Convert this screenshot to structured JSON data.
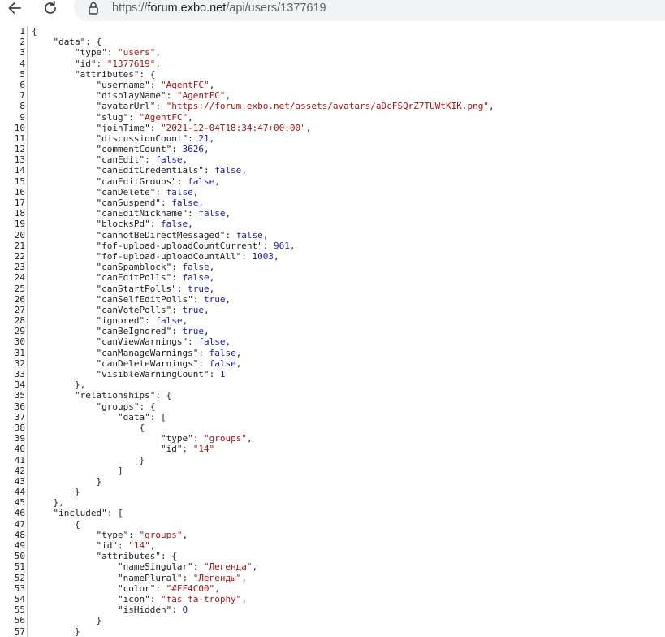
{
  "browser": {
    "url": "https://forum.exbo.net/api/users/1377619",
    "url_scheme": "https://",
    "url_host": "forum.exbo.net",
    "url_path": "/api/users/1377619"
  },
  "lines": [
    {
      "n": "1",
      "indent": "",
      "tokens": [
        [
          "p",
          "{"
        ]
      ]
    },
    {
      "n": "2",
      "indent": "    ",
      "tokens": [
        [
          "k",
          "\"data\""
        ],
        [
          "p",
          ": {"
        ]
      ]
    },
    {
      "n": "3",
      "indent": "        ",
      "tokens": [
        [
          "k",
          "\"type\""
        ],
        [
          "p",
          ": "
        ],
        [
          "s",
          "\"users\""
        ],
        [
          "p",
          ","
        ]
      ]
    },
    {
      "n": "4",
      "indent": "        ",
      "tokens": [
        [
          "k",
          "\"id\""
        ],
        [
          "p",
          ": "
        ],
        [
          "s",
          "\"1377619\""
        ],
        [
          "p",
          ","
        ]
      ]
    },
    {
      "n": "5",
      "indent": "        ",
      "tokens": [
        [
          "k",
          "\"attributes\""
        ],
        [
          "p",
          ": {"
        ]
      ]
    },
    {
      "n": "6",
      "indent": "            ",
      "tokens": [
        [
          "k",
          "\"username\""
        ],
        [
          "p",
          ": "
        ],
        [
          "s",
          "\"AgentFC\""
        ],
        [
          "p",
          ","
        ]
      ]
    },
    {
      "n": "7",
      "indent": "            ",
      "tokens": [
        [
          "k",
          "\"displayName\""
        ],
        [
          "p",
          ": "
        ],
        [
          "s",
          "\"AgentFC\""
        ],
        [
          "p",
          ","
        ]
      ]
    },
    {
      "n": "8",
      "indent": "            ",
      "tokens": [
        [
          "k",
          "\"avatarUrl\""
        ],
        [
          "p",
          ": "
        ],
        [
          "s",
          "\"https://forum.exbo.net/assets/avatars/aDcFSQrZ7TUWtKIK.png\""
        ],
        [
          "p",
          ","
        ]
      ]
    },
    {
      "n": "9",
      "indent": "            ",
      "tokens": [
        [
          "k",
          "\"slug\""
        ],
        [
          "p",
          ": "
        ],
        [
          "s",
          "\"AgentFC\""
        ],
        [
          "p",
          ","
        ]
      ]
    },
    {
      "n": "10",
      "indent": "            ",
      "tokens": [
        [
          "k",
          "\"joinTime\""
        ],
        [
          "p",
          ": "
        ],
        [
          "s",
          "\"2021-12-04T18:34:47+00:00\""
        ],
        [
          "p",
          ","
        ]
      ]
    },
    {
      "n": "11",
      "indent": "            ",
      "tokens": [
        [
          "k",
          "\"discussionCount\""
        ],
        [
          "p",
          ": "
        ],
        [
          "n",
          "21"
        ],
        [
          "p",
          ","
        ]
      ]
    },
    {
      "n": "12",
      "indent": "            ",
      "tokens": [
        [
          "k",
          "\"commentCount\""
        ],
        [
          "p",
          ": "
        ],
        [
          "n",
          "3626"
        ],
        [
          "p",
          ","
        ]
      ]
    },
    {
      "n": "13",
      "indent": "            ",
      "tokens": [
        [
          "k",
          "\"canEdit\""
        ],
        [
          "p",
          ": "
        ],
        [
          "b",
          "false"
        ],
        [
          "p",
          ","
        ]
      ]
    },
    {
      "n": "14",
      "indent": "            ",
      "tokens": [
        [
          "k",
          "\"canEditCredentials\""
        ],
        [
          "p",
          ": "
        ],
        [
          "b",
          "false"
        ],
        [
          "p",
          ","
        ]
      ]
    },
    {
      "n": "15",
      "indent": "            ",
      "tokens": [
        [
          "k",
          "\"canEditGroups\""
        ],
        [
          "p",
          ": "
        ],
        [
          "b",
          "false"
        ],
        [
          "p",
          ","
        ]
      ]
    },
    {
      "n": "16",
      "indent": "            ",
      "tokens": [
        [
          "k",
          "\"canDelete\""
        ],
        [
          "p",
          ": "
        ],
        [
          "b",
          "false"
        ],
        [
          "p",
          ","
        ]
      ]
    },
    {
      "n": "17",
      "indent": "            ",
      "tokens": [
        [
          "k",
          "\"canSuspend\""
        ],
        [
          "p",
          ": "
        ],
        [
          "b",
          "false"
        ],
        [
          "p",
          ","
        ]
      ]
    },
    {
      "n": "18",
      "indent": "            ",
      "tokens": [
        [
          "k",
          "\"canEditNickname\""
        ],
        [
          "p",
          ": "
        ],
        [
          "b",
          "false"
        ],
        [
          "p",
          ","
        ]
      ]
    },
    {
      "n": "19",
      "indent": "            ",
      "tokens": [
        [
          "k",
          "\"blocksPd\""
        ],
        [
          "p",
          ": "
        ],
        [
          "b",
          "false"
        ],
        [
          "p",
          ","
        ]
      ]
    },
    {
      "n": "20",
      "indent": "            ",
      "tokens": [
        [
          "k",
          "\"cannotBeDirectMessaged\""
        ],
        [
          "p",
          ": "
        ],
        [
          "b",
          "false"
        ],
        [
          "p",
          ","
        ]
      ]
    },
    {
      "n": "21",
      "indent": "            ",
      "tokens": [
        [
          "k",
          "\"fof-upload-uploadCountCurrent\""
        ],
        [
          "p",
          ": "
        ],
        [
          "n",
          "961"
        ],
        [
          "p",
          ","
        ]
      ]
    },
    {
      "n": "22",
      "indent": "            ",
      "tokens": [
        [
          "k",
          "\"fof-upload-uploadCountAll\""
        ],
        [
          "p",
          ": "
        ],
        [
          "n",
          "1003"
        ],
        [
          "p",
          ","
        ]
      ]
    },
    {
      "n": "23",
      "indent": "            ",
      "tokens": [
        [
          "k",
          "\"canSpamblock\""
        ],
        [
          "p",
          ": "
        ],
        [
          "b",
          "false"
        ],
        [
          "p",
          ","
        ]
      ]
    },
    {
      "n": "24",
      "indent": "            ",
      "tokens": [
        [
          "k",
          "\"canEditPolls\""
        ],
        [
          "p",
          ": "
        ],
        [
          "b",
          "false"
        ],
        [
          "p",
          ","
        ]
      ]
    },
    {
      "n": "25",
      "indent": "            ",
      "tokens": [
        [
          "k",
          "\"canStartPolls\""
        ],
        [
          "p",
          ": "
        ],
        [
          "b",
          "true"
        ],
        [
          "p",
          ","
        ]
      ]
    },
    {
      "n": "26",
      "indent": "            ",
      "tokens": [
        [
          "k",
          "\"canSelfEditPolls\""
        ],
        [
          "p",
          ": "
        ],
        [
          "b",
          "true"
        ],
        [
          "p",
          ","
        ]
      ]
    },
    {
      "n": "27",
      "indent": "            ",
      "tokens": [
        [
          "k",
          "\"canVotePolls\""
        ],
        [
          "p",
          ": "
        ],
        [
          "b",
          "true"
        ],
        [
          "p",
          ","
        ]
      ]
    },
    {
      "n": "28",
      "indent": "            ",
      "tokens": [
        [
          "k",
          "\"ignored\""
        ],
        [
          "p",
          ": "
        ],
        [
          "b",
          "false"
        ],
        [
          "p",
          ","
        ]
      ]
    },
    {
      "n": "29",
      "indent": "            ",
      "tokens": [
        [
          "k",
          "\"canBeIgnored\""
        ],
        [
          "p",
          ": "
        ],
        [
          "b",
          "true"
        ],
        [
          "p",
          ","
        ]
      ]
    },
    {
      "n": "30",
      "indent": "            ",
      "tokens": [
        [
          "k",
          "\"canViewWarnings\""
        ],
        [
          "p",
          ": "
        ],
        [
          "b",
          "false"
        ],
        [
          "p",
          ","
        ]
      ]
    },
    {
      "n": "31",
      "indent": "            ",
      "tokens": [
        [
          "k",
          "\"canManageWarnings\""
        ],
        [
          "p",
          ": "
        ],
        [
          "b",
          "false"
        ],
        [
          "p",
          ","
        ]
      ]
    },
    {
      "n": "32",
      "indent": "            ",
      "tokens": [
        [
          "k",
          "\"canDeleteWarnings\""
        ],
        [
          "p",
          ": "
        ],
        [
          "b",
          "false"
        ],
        [
          "p",
          ","
        ]
      ]
    },
    {
      "n": "33",
      "indent": "            ",
      "tokens": [
        [
          "k",
          "\"visibleWarningCount\""
        ],
        [
          "p",
          ": "
        ],
        [
          "n",
          "1"
        ]
      ]
    },
    {
      "n": "34",
      "indent": "        ",
      "tokens": [
        [
          "p",
          "},"
        ]
      ]
    },
    {
      "n": "35",
      "indent": "        ",
      "tokens": [
        [
          "k",
          "\"relationships\""
        ],
        [
          "p",
          ": {"
        ]
      ]
    },
    {
      "n": "36",
      "indent": "            ",
      "tokens": [
        [
          "k",
          "\"groups\""
        ],
        [
          "p",
          ": {"
        ]
      ]
    },
    {
      "n": "37",
      "indent": "                ",
      "tokens": [
        [
          "k",
          "\"data\""
        ],
        [
          "p",
          ": ["
        ]
      ]
    },
    {
      "n": "38",
      "indent": "                    ",
      "tokens": [
        [
          "p",
          "{"
        ]
      ]
    },
    {
      "n": "39",
      "indent": "                        ",
      "tokens": [
        [
          "k",
          "\"type\""
        ],
        [
          "p",
          ": "
        ],
        [
          "s",
          "\"groups\""
        ],
        [
          "p",
          ","
        ]
      ]
    },
    {
      "n": "40",
      "indent": "                        ",
      "tokens": [
        [
          "k",
          "\"id\""
        ],
        [
          "p",
          ": "
        ],
        [
          "s",
          "\"14\""
        ]
      ]
    },
    {
      "n": "41",
      "indent": "                    ",
      "tokens": [
        [
          "p",
          "}"
        ]
      ]
    },
    {
      "n": "42",
      "indent": "                ",
      "tokens": [
        [
          "p",
          "]"
        ]
      ]
    },
    {
      "n": "43",
      "indent": "            ",
      "tokens": [
        [
          "p",
          "}"
        ]
      ]
    },
    {
      "n": "44",
      "indent": "        ",
      "tokens": [
        [
          "p",
          "}"
        ]
      ]
    },
    {
      "n": "45",
      "indent": "    ",
      "tokens": [
        [
          "p",
          "},"
        ]
      ]
    },
    {
      "n": "46",
      "indent": "    ",
      "tokens": [
        [
          "k",
          "\"included\""
        ],
        [
          "p",
          ": ["
        ]
      ]
    },
    {
      "n": "47",
      "indent": "        ",
      "tokens": [
        [
          "p",
          "{"
        ]
      ]
    },
    {
      "n": "48",
      "indent": "            ",
      "tokens": [
        [
          "k",
          "\"type\""
        ],
        [
          "p",
          ": "
        ],
        [
          "s",
          "\"groups\""
        ],
        [
          "p",
          ","
        ]
      ]
    },
    {
      "n": "49",
      "indent": "            ",
      "tokens": [
        [
          "k",
          "\"id\""
        ],
        [
          "p",
          ": "
        ],
        [
          "s",
          "\"14\""
        ],
        [
          "p",
          ","
        ]
      ]
    },
    {
      "n": "50",
      "indent": "            ",
      "tokens": [
        [
          "k",
          "\"attributes\""
        ],
        [
          "p",
          ": {"
        ]
      ]
    },
    {
      "n": "51",
      "indent": "                ",
      "tokens": [
        [
          "k",
          "\"nameSingular\""
        ],
        [
          "p",
          ": "
        ],
        [
          "s",
          "\"Легенда\""
        ],
        [
          "p",
          ","
        ]
      ]
    },
    {
      "n": "52",
      "indent": "                ",
      "tokens": [
        [
          "k",
          "\"namePlural\""
        ],
        [
          "p",
          ": "
        ],
        [
          "s",
          "\"Легенды\""
        ],
        [
          "p",
          ","
        ]
      ]
    },
    {
      "n": "53",
      "indent": "                ",
      "tokens": [
        [
          "k",
          "\"color\""
        ],
        [
          "p",
          ": "
        ],
        [
          "s",
          "\"#FF4C00\""
        ],
        [
          "p",
          ","
        ]
      ]
    },
    {
      "n": "54",
      "indent": "                ",
      "tokens": [
        [
          "k",
          "\"icon\""
        ],
        [
          "p",
          ": "
        ],
        [
          "s",
          "\"fas fa-trophy\""
        ],
        [
          "p",
          ","
        ]
      ]
    },
    {
      "n": "55",
      "indent": "                ",
      "tokens": [
        [
          "k",
          "\"isHidden\""
        ],
        [
          "p",
          ": "
        ],
        [
          "n",
          "0"
        ]
      ]
    },
    {
      "n": "56",
      "indent": "            ",
      "tokens": [
        [
          "p",
          "}"
        ]
      ]
    },
    {
      "n": "57",
      "indent": "        ",
      "tokens": [
        [
          "p",
          "}"
        ]
      ]
    }
  ]
}
